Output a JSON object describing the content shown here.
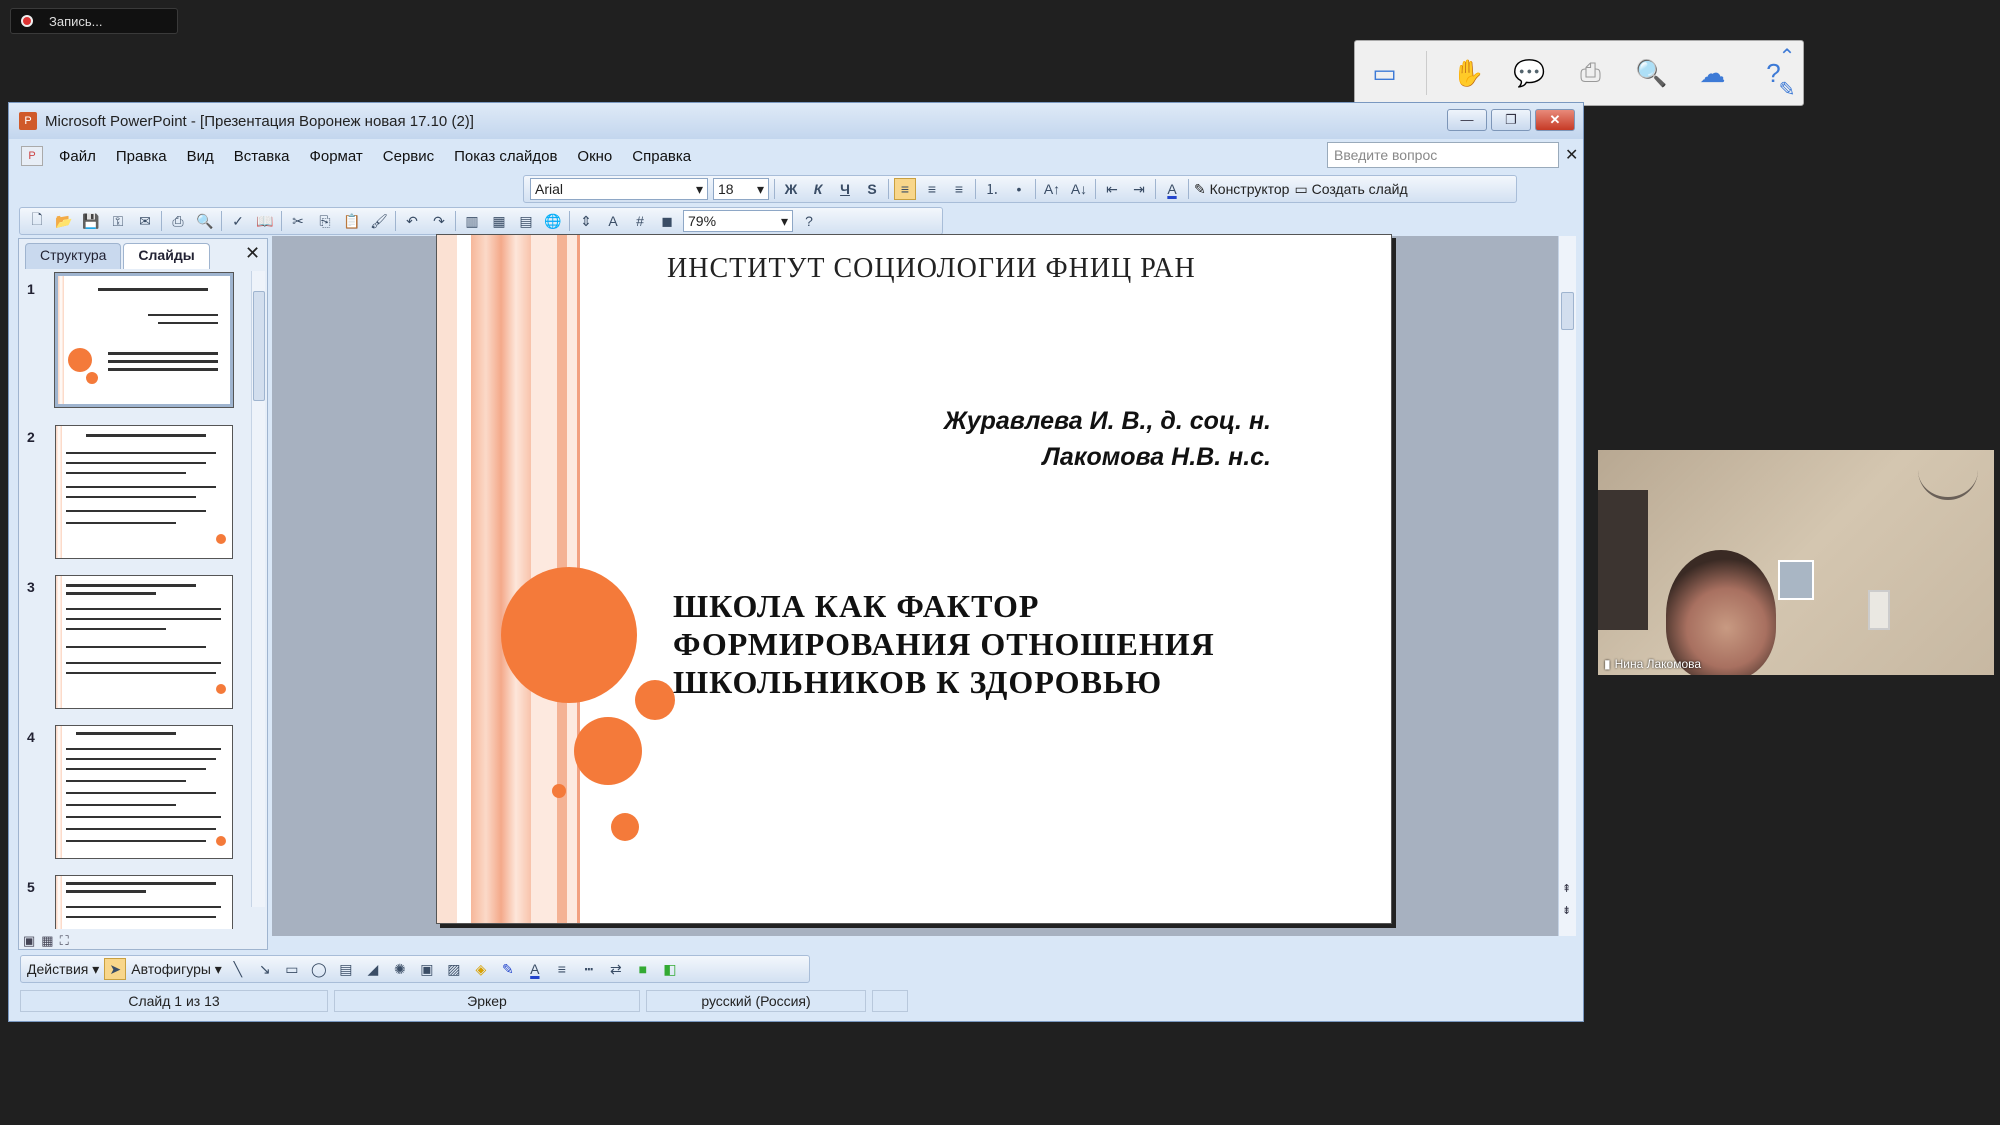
{
  "recording": {
    "label": "Запись..."
  },
  "window": {
    "title": "Microsoft PowerPoint - [Презентация Воронеж  новая 17.10 (2)]",
    "minimize": "—",
    "restore": "❐",
    "close": "✕"
  },
  "menu": {
    "items": [
      "Файл",
      "Правка",
      "Вид",
      "Вставка",
      "Формат",
      "Сервис",
      "Показ слайдов",
      "Окно",
      "Справка"
    ],
    "ask_placeholder": "Введите вопрос"
  },
  "format_toolbar": {
    "font": "Arial",
    "size": "18",
    "bold": "Ж",
    "italic": "К",
    "underline": "Ч",
    "shadow": "S",
    "design_label": "Конструктор",
    "new_slide_label": "Создать слайд"
  },
  "standard_toolbar": {
    "zoom": "79%"
  },
  "left_pane": {
    "tab_outline": "Структура",
    "tab_slides": "Слайды",
    "slide_numbers": [
      "1",
      "2",
      "3",
      "4",
      "5"
    ]
  },
  "slide": {
    "header": "ИНСТИТУТ  СОЦИОЛОГИИ ФНИЦ РАН",
    "author1": "Журавлева И. В., д. соц. н.",
    "author2": "Лакомова Н.В. н.с.",
    "title_line1": "ШКОЛА КАК ФАКТОР",
    "title_line2": "ФОРМИРОВАНИЯ ОТНОШЕНИЯ",
    "title_line3": "ШКОЛЬНИКОВ К ЗДОРОВЬЮ"
  },
  "draw_toolbar": {
    "actions": "Действия",
    "autoshapes": "Автофигуры"
  },
  "status": {
    "slide_of": "Слайд 1 из 13",
    "design": "Эркер",
    "language": "русский (Россия)"
  },
  "webcam": {
    "name": "Нина Лакомова"
  },
  "colors": {
    "accent_orange": "#f47a3a",
    "window_frame": "#d9e7f7",
    "slide_bg": "#a7b1c0"
  }
}
